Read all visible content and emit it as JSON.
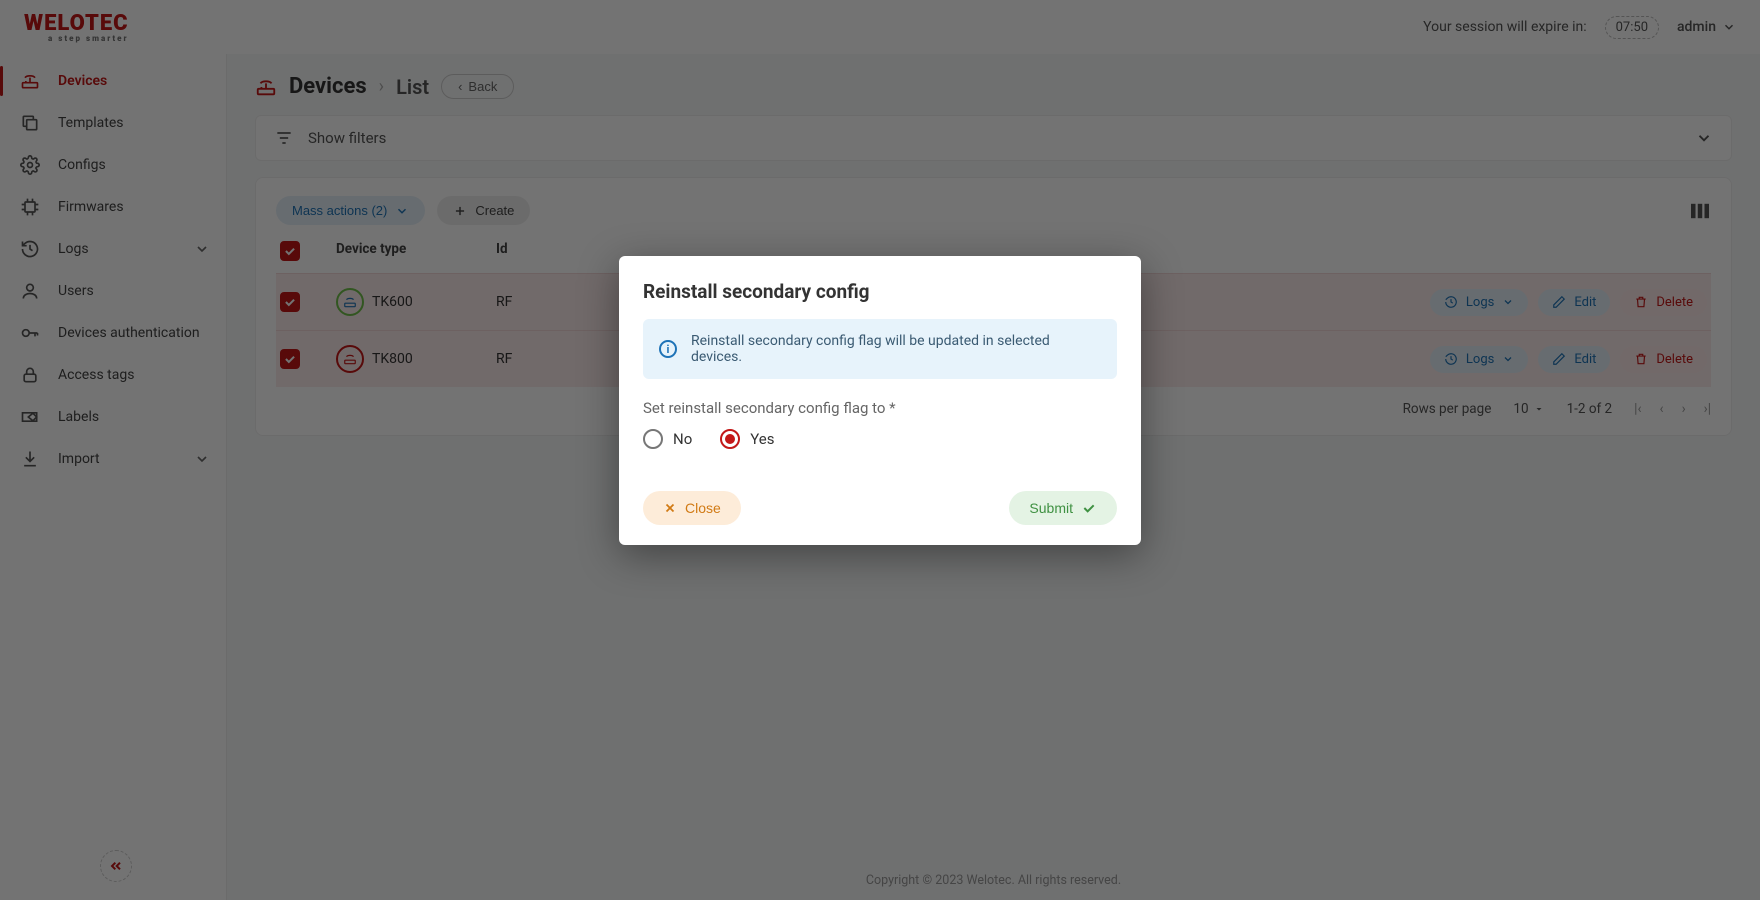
{
  "brand": {
    "name": "WELOTEC",
    "tagline": "a step smarter"
  },
  "header": {
    "session_label": "Your session will expire in:",
    "session_time": "07:50",
    "user": "admin"
  },
  "sidebar": {
    "items": [
      {
        "label": "Devices",
        "active": true
      },
      {
        "label": "Templates"
      },
      {
        "label": "Configs"
      },
      {
        "label": "Firmwares"
      },
      {
        "label": "Logs",
        "expandable": true
      },
      {
        "label": "Users"
      },
      {
        "label": "Devices authentication"
      },
      {
        "label": "Access tags"
      },
      {
        "label": "Labels"
      },
      {
        "label": "Import",
        "expandable": true
      }
    ]
  },
  "breadcrumb": {
    "title": "Devices",
    "sub": "List",
    "back": "Back"
  },
  "filters": {
    "label": "Show filters"
  },
  "toolbar": {
    "mass_actions": "Mass actions (2)",
    "create": "Create"
  },
  "table": {
    "headers": {
      "type": "Device type",
      "id": "Id"
    },
    "rows_per_page_label": "Rows per page",
    "rows_per_page": "10",
    "range": "1-2 of 2",
    "rows": [
      {
        "type": "TK600",
        "id": "RF",
        "badge_color": "green"
      },
      {
        "type": "TK800",
        "id": "RF",
        "badge_color": "red"
      }
    ],
    "actions": {
      "logs": "Logs",
      "edit": "Edit",
      "delete": "Delete"
    }
  },
  "footer": "Copyright © 2023 Welotec. All rights reserved.",
  "modal": {
    "title": "Reinstall secondary config",
    "info": "Reinstall secondary config flag will be updated in selected devices.",
    "field_label": "Set reinstall secondary config flag to *",
    "option_no": "No",
    "option_yes": "Yes",
    "selected": "yes",
    "close": "Close",
    "submit": "Submit"
  }
}
